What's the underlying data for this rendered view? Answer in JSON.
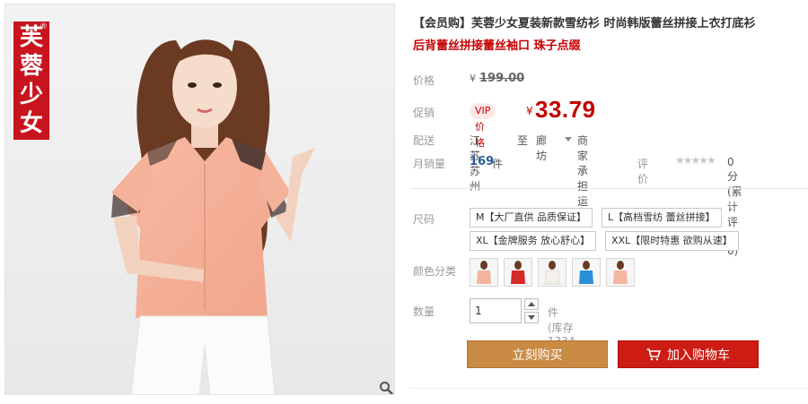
{
  "brand": {
    "logo_text": [
      "芙",
      "蓉",
      "少",
      "女"
    ],
    "logo_mark": "®"
  },
  "product": {
    "title": "【会员购】芙蓉少女夏装新款雪纺衫 时尚韩版蕾丝拼接上衣打底衫",
    "subtitle": "后背蕾丝拼接蕾丝袖口 珠子点缀"
  },
  "price": {
    "label": "价格",
    "currency": "¥",
    "original": "199.00"
  },
  "promo": {
    "label": "促销",
    "vip_tag": "VIP价格",
    "currency": "¥",
    "price": "33.79"
  },
  "shipping": {
    "label": "配送",
    "from": "江苏苏州",
    "to_word": "至",
    "destination": "廊坊",
    "fee_note": "商家承担运费"
  },
  "sales": {
    "label": "月销量",
    "count": "169",
    "unit": "件",
    "eval_label": "评价",
    "stars": "★★★★★",
    "eval_value": "0分(累计评价0)"
  },
  "sizes": {
    "label": "尺码",
    "options": [
      "M【大厂直供 品质保证】",
      "L【高档雪纺 蕾丝拼接】",
      "XL【金牌服务 放心舒心】",
      "XXL【限时特惠 欲购从速】"
    ]
  },
  "colors": {
    "label": "颜色分类",
    "swatches": [
      "#f2b49c",
      "#d42a2a",
      "#f3f0ea",
      "#2a8fd6",
      "#f4b69e"
    ]
  },
  "quantity": {
    "label": "数量",
    "value": "1",
    "unit_stock": "件 (库存1334件)"
  },
  "actions": {
    "buy_now": "立刻购买",
    "add_to_cart": "加入购物车"
  },
  "colors_theme": {
    "accent_red": "#c40000",
    "buy_button": "#c98b43",
    "cart_button": "#cc1c14"
  }
}
